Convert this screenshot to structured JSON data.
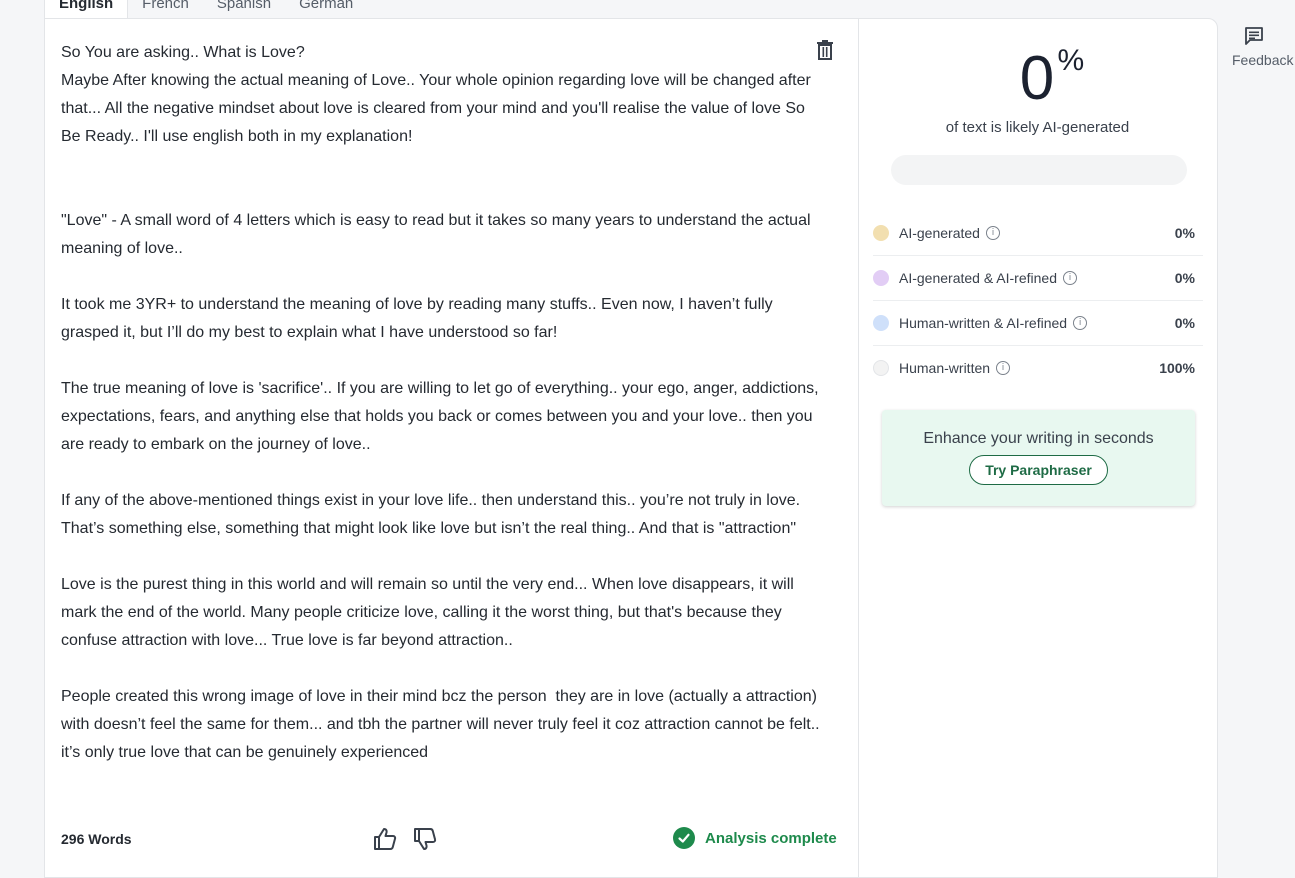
{
  "tabs": [
    "English",
    "French",
    "Spanish",
    "German"
  ],
  "editor": {
    "paragraphs": [
      "So You are asking.. What is Love?",
      "Maybe After knowing the actual meaning of Love.. Your whole opinion regarding love will be changed after that... All the negative mindset about love is cleared from your mind and you'll realise the value of love So Be Ready.. I'll use english both in my explanation!",
      "",
      "",
      "\"Love\" - A small word of 4 letters which is easy to read but it takes so many years to understand the actual meaning of love..",
      "",
      "It took me 3YR+ to understand the meaning of love by reading many stuffs.. Even now, I haven’t fully grasped it, but I’ll do my best to explain what I have understood so far!",
      "",
      "The true meaning of love is 'sacrifice'.. If you are willing to let go of everything.. your ego, anger, addictions, expectations, fears, and anything else that holds you back or comes between you and your love.. then you are ready to embark on the journey of love..",
      "",
      "If any of the above-mentioned things exist in your love life.. then understand this.. you’re not truly in love. That’s something else, something that might look like love but isn’t the real thing.. And that is \"attraction\"",
      "",
      "Love is the purest thing in this world and will remain so until the very end... When love disappears, it will mark the end of the world. Many people criticize love, calling it the worst thing, but that's because they confuse attraction with love... True love is far beyond attraction..",
      "",
      "People created this wrong image of love in their mind bcz the person  they are in love (actually a attraction) with doesn’t feel the same for them... and tbh the partner will never truly feel it coz attraction cannot be felt.. it’s only true love that can be genuinely experienced"
    ],
    "icons": {
      "delete": "trash-icon",
      "like": "thumbs-up-icon",
      "dislike": "thumbs-down-icon",
      "status": "check-circle-icon"
    }
  },
  "footer": {
    "word_count": "296 Words",
    "status": "Analysis complete"
  },
  "results": {
    "score_value": "0",
    "score_unit": "%",
    "ai_fraction": 0,
    "caption": "of text is likely AI-generated",
    "breakdown": [
      {
        "label": "AI-generated",
        "value": "0%",
        "color": "#f2dfb0"
      },
      {
        "label": "AI-generated & AI-refined",
        "value": "0%",
        "color": "#e2cdf5"
      },
      {
        "label": "Human-written & AI-refined",
        "value": "0%",
        "color": "#cfe0fa"
      },
      {
        "label": "Human-written",
        "value": "100%",
        "color": "#f3f3f3"
      }
    ],
    "promo": {
      "title": "Enhance your writing in seconds",
      "button": "Try Paraphraser"
    }
  },
  "sidebar": {
    "feedback_label": "Feedback",
    "feedback_icon": "feedback-icon"
  },
  "colors": {
    "accent": "#1e8a4c",
    "promo_bg": "#e8f8f0",
    "text": "#252a31"
  }
}
